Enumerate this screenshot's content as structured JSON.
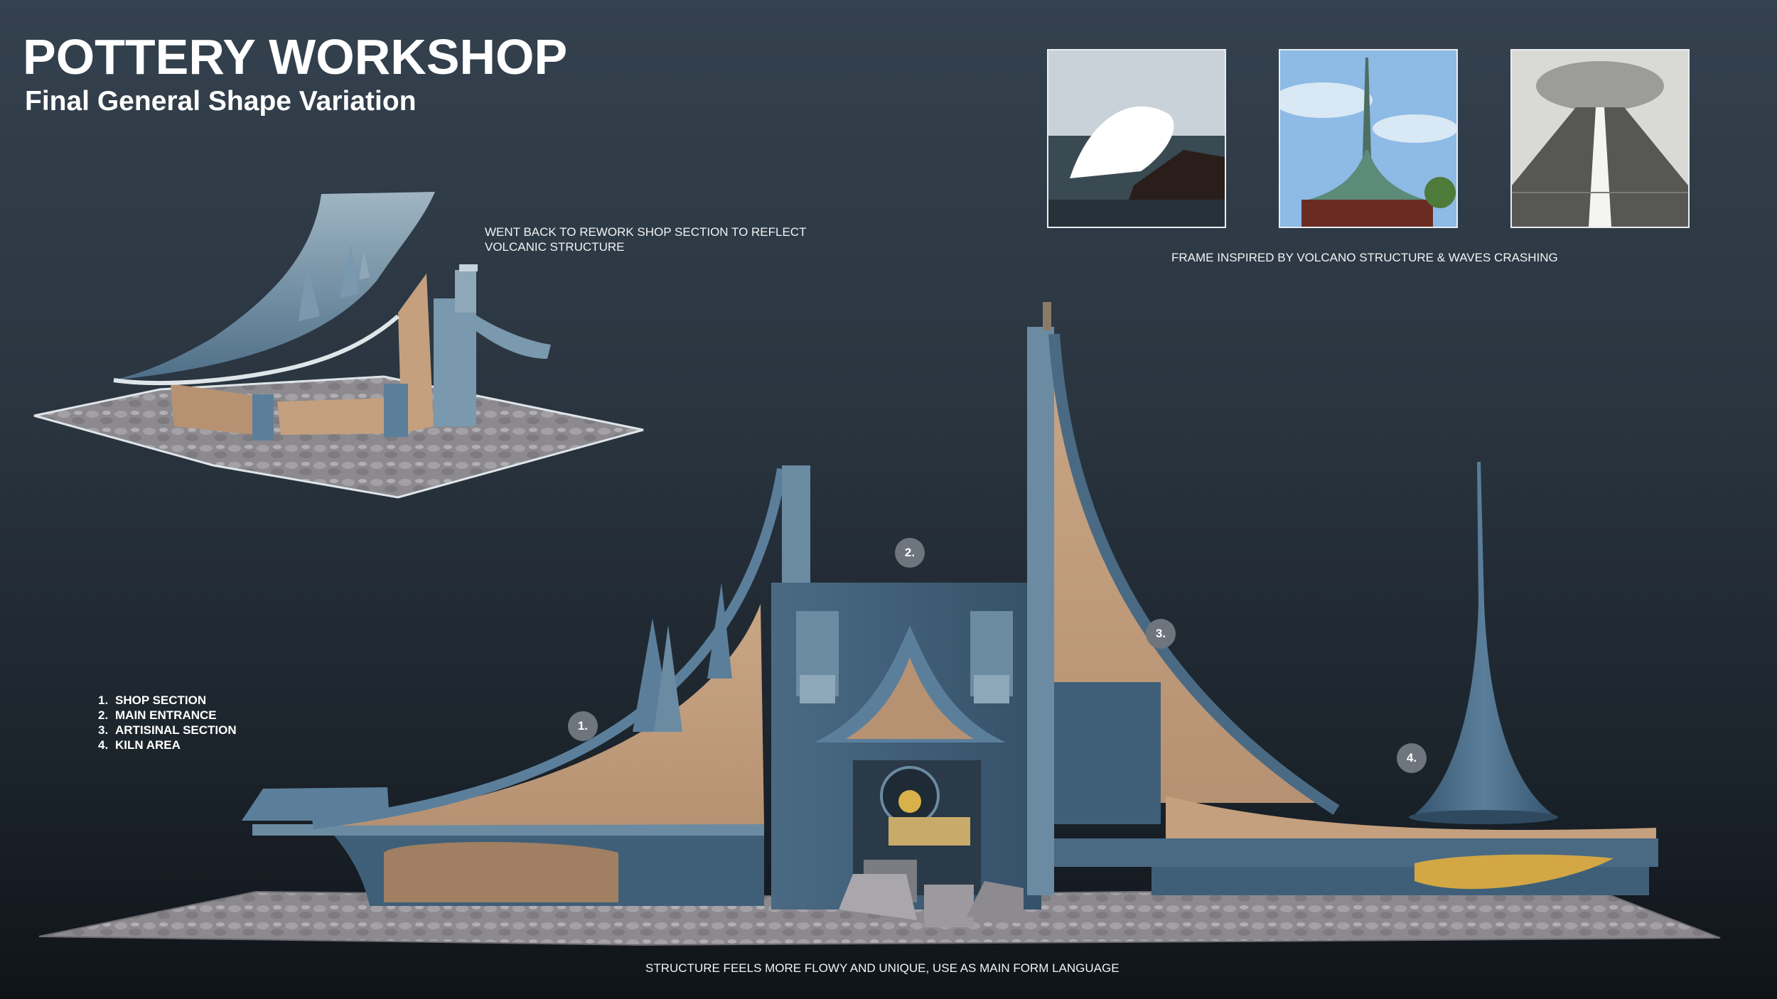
{
  "header": {
    "title": "POTTERY WORKSHOP",
    "subtitle": "Final General Shape Variation"
  },
  "notes": {
    "shop_rework": "WENT BACK TO REWORK SHOP SECTION TO REFLECT VOLCANIC STRUCTURE",
    "frame_inspiration": "FRAME INSPIRED BY VOLCANO STRUCTURE & WAVES CRASHING",
    "bottom_caption": "STRUCTURE FEELS MORE FLOWY AND UNIQUE, USE AS MAIN FORM LANGUAGE"
  },
  "legend": [
    {
      "number": "1.",
      "label": "SHOP SECTION"
    },
    {
      "number": "2.",
      "label": "MAIN ENTRANCE"
    },
    {
      "number": "3.",
      "label": "ARTISINAL SECTION"
    },
    {
      "number": "4.",
      "label": "KILN AREA"
    }
  ],
  "markers": [
    "1.",
    "2.",
    "3.",
    "4."
  ],
  "reference_images": [
    {
      "subject": "waves crashing on rocks"
    },
    {
      "subject": "temple roof with spire"
    },
    {
      "subject": "volcano engraving"
    }
  ],
  "colors": {
    "background_top": "#34414e",
    "background_bottom": "#0f1419",
    "roof_blue": "#5b7f9b",
    "structure_blue": "#3f5f78",
    "sand_wall": "#c4a07e",
    "stone": "#8f8f93",
    "marker_gray": "#6e757c",
    "text": "#ffffff"
  }
}
